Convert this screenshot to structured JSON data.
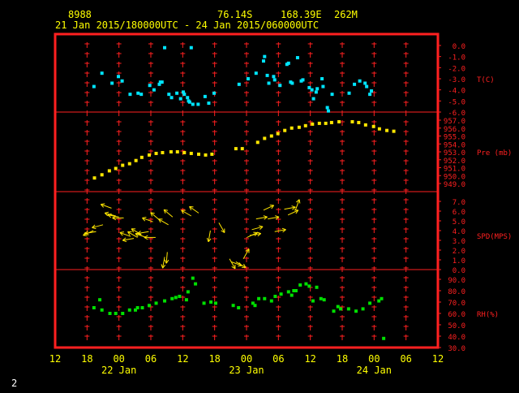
{
  "header": {
    "station_id": "8988",
    "lat": "76.14S",
    "lon": "168.39E",
    "elevation": "262M",
    "range": "21 Jan 2015/180000UTC - 24 Jan 2015/060000UTC"
  },
  "footer": {
    "page": "2"
  },
  "colors": {
    "background": "#000000",
    "frame": "#ff2020",
    "grid": "#ff2020",
    "header_text": "#ffff00",
    "footer_text": "#ffffff",
    "temperature": "#00e5ff",
    "pressure": "#ffe600",
    "wind": "#ffe600",
    "humidity": "#00e000"
  },
  "chart_data": {
    "type": "scatter",
    "x_axis": {
      "unit": "hours since 21 Jan 2015 12 UTC",
      "range": [
        0,
        72
      ],
      "ticks": [
        {
          "x": 0,
          "label": "12"
        },
        {
          "x": 6,
          "label": "18"
        },
        {
          "x": 12,
          "label": "00"
        },
        {
          "x": 18,
          "label": "06"
        },
        {
          "x": 24,
          "label": "12"
        },
        {
          "x": 30,
          "label": "18"
        },
        {
          "x": 36,
          "label": "00"
        },
        {
          "x": 42,
          "label": "06"
        },
        {
          "x": 48,
          "label": "12"
        },
        {
          "x": 54,
          "label": "18"
        },
        {
          "x": 60,
          "label": "00"
        },
        {
          "x": 66,
          "label": "06"
        },
        {
          "x": 72,
          "label": "12"
        }
      ],
      "day_labels": [
        {
          "x": 12,
          "label": "22 Jan"
        },
        {
          "x": 36,
          "label": "23 Jan"
        },
        {
          "x": 60,
          "label": "24 Jan"
        }
      ]
    },
    "panels": [
      {
        "id": "temperature",
        "label": "T(C)",
        "ylim": [
          -6,
          0
        ],
        "ticks": [
          "0.0",
          "-1.0",
          "-2.0",
          "-3.0",
          "-4.0",
          "-5.0",
          "-6.0"
        ],
        "points": [
          [
            7.3,
            -3.7
          ],
          [
            8.8,
            -2.5
          ],
          [
            10.7,
            -3.4
          ],
          [
            11.9,
            -2.8
          ],
          [
            12.6,
            -3.2
          ],
          [
            14.1,
            -4.4
          ],
          [
            15.6,
            -4.3
          ],
          [
            16.2,
            -4.4
          ],
          [
            17.8,
            -3.6
          ],
          [
            18.6,
            -4.0
          ],
          [
            19.6,
            -3.5
          ],
          [
            19.8,
            -3.3
          ],
          [
            20.1,
            -3.3
          ],
          [
            20.6,
            -0.2
          ],
          [
            21.4,
            -4.4
          ],
          [
            21.9,
            -4.7
          ],
          [
            22.9,
            -4.3
          ],
          [
            23.6,
            -4.8
          ],
          [
            24.1,
            -4.2
          ],
          [
            24.3,
            -4.4
          ],
          [
            24.9,
            -4.7
          ],
          [
            25.1,
            -5.0
          ],
          [
            25.3,
            -5.1
          ],
          [
            25.6,
            -0.2
          ],
          [
            25.9,
            -5.3
          ],
          [
            26.9,
            -5.3
          ],
          [
            28.2,
            -4.6
          ],
          [
            28.9,
            -5.2
          ],
          [
            29.9,
            -4.3
          ],
          [
            34.6,
            -3.5
          ],
          [
            36.3,
            -3.0
          ],
          [
            37.8,
            -2.5
          ],
          [
            39.2,
            -1.4
          ],
          [
            39.4,
            -1.0
          ],
          [
            39.9,
            -2.7
          ],
          [
            40.2,
            -3.4
          ],
          [
            41.1,
            -2.8
          ],
          [
            41.3,
            -3.1
          ],
          [
            42.3,
            -3.6
          ],
          [
            43.6,
            -1.7
          ],
          [
            43.9,
            -1.6
          ],
          [
            44.3,
            -3.3
          ],
          [
            44.6,
            -3.4
          ],
          [
            45.6,
            -1.1
          ],
          [
            46.3,
            -3.2
          ],
          [
            46.6,
            -3.1
          ],
          [
            47.8,
            -3.8
          ],
          [
            48.3,
            -4.0
          ],
          [
            48.6,
            -4.8
          ],
          [
            49.1,
            -4.2
          ],
          [
            49.3,
            -3.9
          ],
          [
            50.2,
            -3.0
          ],
          [
            50.4,
            -3.7
          ],
          [
            51.2,
            -5.6
          ],
          [
            51.4,
            -5.9
          ],
          [
            52.1,
            -4.4
          ],
          [
            55.3,
            -4.3
          ],
          [
            56.3,
            -3.5
          ],
          [
            57.3,
            -3.2
          ],
          [
            58.3,
            -3.4
          ],
          [
            58.6,
            -3.7
          ],
          [
            59.2,
            -4.4
          ],
          [
            59.5,
            -4.1
          ]
        ]
      },
      {
        "id": "pressure",
        "label": "Pre (mb)",
        "ylim": [
          949,
          957
        ],
        "ticks": [
          "957.0",
          "956.0",
          "955.0",
          "954.0",
          "953.0",
          "952.0",
          "951.0",
          "950.0",
          "949.0"
        ],
        "points": [
          [
            7.4,
            949.7
          ],
          [
            8.8,
            950.1
          ],
          [
            10.2,
            950.6
          ],
          [
            11.4,
            950.9
          ],
          [
            12.7,
            951.3
          ],
          [
            14.0,
            951.5
          ],
          [
            15.2,
            951.9
          ],
          [
            16.3,
            952.3
          ],
          [
            17.7,
            952.6
          ],
          [
            19.0,
            952.8
          ],
          [
            20.2,
            952.9
          ],
          [
            21.8,
            953.0
          ],
          [
            23.0,
            953.0
          ],
          [
            24.3,
            952.9
          ],
          [
            25.6,
            952.8
          ],
          [
            27.0,
            952.7
          ],
          [
            28.3,
            952.6
          ],
          [
            29.5,
            952.7
          ],
          [
            34.0,
            953.4
          ],
          [
            35.2,
            953.4
          ],
          [
            38.1,
            954.2
          ],
          [
            39.4,
            954.7
          ],
          [
            40.7,
            955.0
          ],
          [
            41.9,
            955.3
          ],
          [
            43.2,
            955.7
          ],
          [
            44.5,
            956.0
          ],
          [
            45.9,
            956.1
          ],
          [
            47.1,
            956.3
          ],
          [
            48.4,
            956.5
          ],
          [
            49.7,
            956.6
          ],
          [
            50.9,
            956.6
          ],
          [
            52.0,
            956.7
          ],
          [
            53.4,
            956.8
          ],
          [
            55.9,
            956.8
          ],
          [
            57.1,
            956.7
          ],
          [
            58.4,
            956.4
          ],
          [
            59.9,
            956.2
          ],
          [
            61.0,
            955.9
          ],
          [
            62.4,
            955.7
          ],
          [
            63.7,
            955.6
          ]
        ]
      },
      {
        "id": "wind",
        "label": "SPD(MPS)",
        "ylim": [
          0,
          7
        ],
        "ticks": [
          "7.0",
          "6.0",
          "5.0",
          "4.0",
          "3.0",
          "2.0",
          "1.0",
          "0.0"
        ],
        "arrows": [
          [
            7.2,
            4.0,
            -155
          ],
          [
            7.7,
            3.9,
            -170
          ],
          [
            9.0,
            4.6,
            -165
          ],
          [
            10.6,
            6.3,
            -200
          ],
          [
            11.4,
            5.5,
            -195
          ],
          [
            12.0,
            5.4,
            -190
          ],
          [
            12.9,
            5.3,
            -180
          ],
          [
            14.2,
            3.4,
            -200
          ],
          [
            14.8,
            3.2,
            -170
          ],
          [
            15.5,
            3.3,
            -210
          ],
          [
            16.2,
            3.6,
            -210
          ],
          [
            17.1,
            3.3,
            -200
          ],
          [
            17.6,
            3.9,
            -170
          ],
          [
            18.4,
            4.9,
            -200
          ],
          [
            18.9,
            3.3,
            -180
          ],
          [
            19.6,
            5.1,
            -220
          ],
          [
            20.6,
            1.3,
            -100
          ],
          [
            21.1,
            1.8,
            -95
          ],
          [
            21.3,
            4.6,
            -210
          ],
          [
            22.1,
            5.4,
            -220
          ],
          [
            25.6,
            5.5,
            -210
          ],
          [
            27.0,
            5.8,
            -215
          ],
          [
            29.2,
            4.0,
            -100
          ],
          [
            30.8,
            4.8,
            -60
          ],
          [
            32.8,
            1.1,
            -60
          ],
          [
            33.1,
            0.8,
            -20
          ],
          [
            34.0,
            0.8,
            -30
          ],
          [
            35.4,
            1.1,
            60
          ],
          [
            36.1,
            3.3,
            25
          ],
          [
            36.6,
            3.5,
            10
          ],
          [
            37.0,
            4.1,
            15
          ],
          [
            37.8,
            5.2,
            10
          ],
          [
            39.2,
            6.1,
            25
          ],
          [
            40.0,
            5.2,
            10
          ],
          [
            41.3,
            3.9,
            10
          ],
          [
            43.1,
            6.2,
            10
          ],
          [
            43.8,
            5.6,
            25
          ],
          [
            45.2,
            6.1,
            70
          ]
        ]
      },
      {
        "id": "humidity",
        "label": "RH(%)",
        "ylim": [
          30,
          90
        ],
        "ticks": [
          "90.0",
          "80.0",
          "70.0",
          "60.0",
          "50.0",
          "40.0",
          "30.0"
        ],
        "points": [
          [
            7.3,
            65.0
          ],
          [
            8.4,
            72.0
          ],
          [
            8.8,
            63.0
          ],
          [
            10.3,
            60.0
          ],
          [
            11.4,
            60.0
          ],
          [
            12.7,
            60.0
          ],
          [
            14.0,
            63.0
          ],
          [
            15.1,
            63.0
          ],
          [
            15.5,
            65.0
          ],
          [
            16.4,
            65.0
          ],
          [
            17.7,
            67.0
          ],
          [
            19.0,
            69.0
          ],
          [
            20.6,
            71.0
          ],
          [
            22.0,
            73.0
          ],
          [
            22.7,
            74.0
          ],
          [
            23.4,
            75.0
          ],
          [
            24.7,
            72.0
          ],
          [
            25.0,
            79.0
          ],
          [
            25.9,
            91.0
          ],
          [
            26.4,
            86.0
          ],
          [
            28.0,
            69.0
          ],
          [
            29.3,
            70.0
          ],
          [
            30.2,
            69.0
          ],
          [
            33.5,
            67.0
          ],
          [
            34.5,
            65.0
          ],
          [
            37.2,
            69.0
          ],
          [
            37.6,
            67.0
          ],
          [
            38.3,
            73.0
          ],
          [
            39.4,
            73.0
          ],
          [
            40.7,
            71.0
          ],
          [
            41.4,
            75.0
          ],
          [
            42.5,
            77.0
          ],
          [
            43.9,
            79.0
          ],
          [
            44.5,
            76.0
          ],
          [
            44.9,
            80.0
          ],
          [
            45.3,
            80.0
          ],
          [
            46.1,
            85.0
          ],
          [
            47.2,
            86.0
          ],
          [
            47.8,
            84.0
          ],
          [
            48.5,
            71.0
          ],
          [
            49.2,
            83.0
          ],
          [
            50.0,
            73.0
          ],
          [
            50.6,
            72.0
          ],
          [
            52.4,
            62.0
          ],
          [
            53.2,
            66.0
          ],
          [
            53.7,
            64.0
          ],
          [
            55.2,
            64.0
          ],
          [
            56.6,
            62.0
          ],
          [
            57.9,
            64.0
          ],
          [
            59.2,
            69.0
          ],
          [
            60.9,
            71.0
          ],
          [
            61.4,
            73.0
          ],
          [
            61.8,
            38.0
          ]
        ]
      }
    ]
  }
}
